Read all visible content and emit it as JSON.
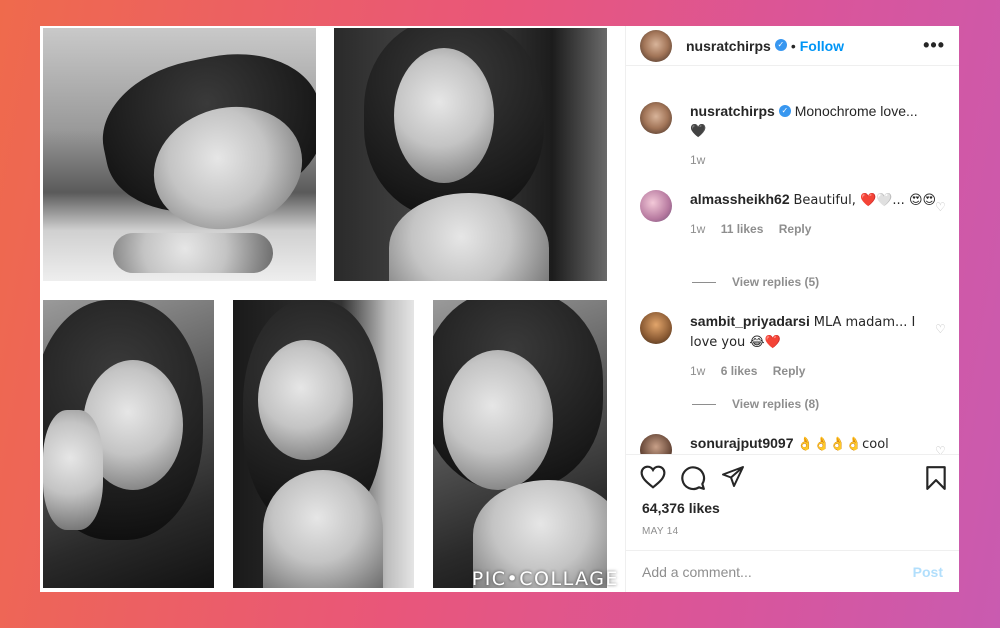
{
  "post": {
    "username": "nusratchirps",
    "follow_label": "Follow",
    "separator": "•",
    "more_label": "•••",
    "watermark": "PIC•COLLAGE"
  },
  "caption": {
    "username": "nusratchirps",
    "text": "Monochrome love...",
    "emoji": "🖤",
    "time": "1w"
  },
  "comments": [
    {
      "username": "almassheikh62",
      "text": "Beautiful, ❤️🤍... 😍😍",
      "time": "1w",
      "likes": "11 likes",
      "reply": "Reply",
      "view_replies": "View replies (5)"
    },
    {
      "username": "sambit_priyadarsi",
      "text": "MLA madam... I love you 😂❤️",
      "time": "1w",
      "likes": "6 likes",
      "reply": "Reply",
      "view_replies": "View replies (8)"
    },
    {
      "username": "sonurajput9097",
      "text": "👌👌👌👌cool"
    }
  ],
  "engagement": {
    "likes": "64,376 likes",
    "date": "MAY 14"
  },
  "add_comment": {
    "placeholder": "Add a comment...",
    "post_label": "Post"
  },
  "colors": {
    "link_blue": "#0095f6",
    "verified_blue": "#3897f0",
    "muted": "#8e8e8e",
    "text": "#262626"
  },
  "icons": {
    "like": "heart-icon",
    "comment": "comment-icon",
    "share": "share-icon",
    "save": "bookmark-icon",
    "verified": "verified-badge-icon"
  }
}
